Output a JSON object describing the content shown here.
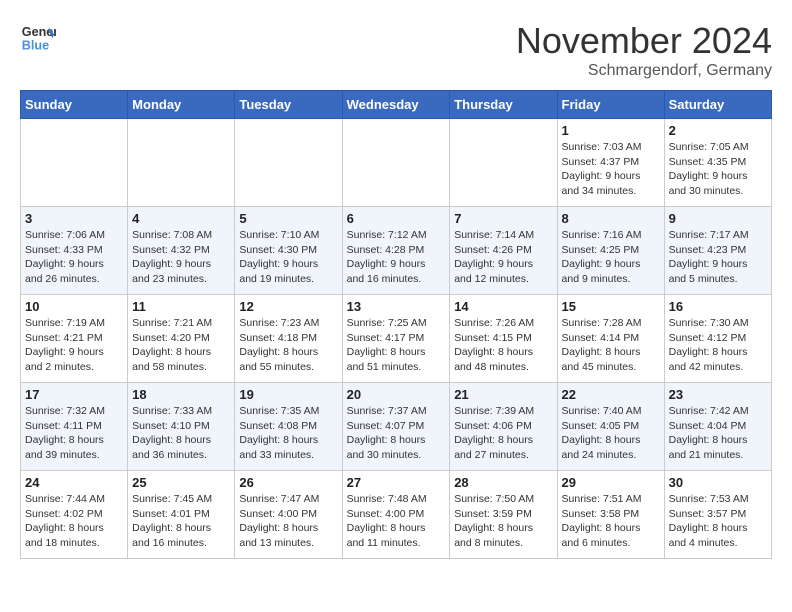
{
  "logo": {
    "line1": "General",
    "line2": "Blue"
  },
  "title": "November 2024",
  "location": "Schmargendorf, Germany",
  "headers": [
    "Sunday",
    "Monday",
    "Tuesday",
    "Wednesday",
    "Thursday",
    "Friday",
    "Saturday"
  ],
  "weeks": [
    [
      {
        "day": "",
        "info": ""
      },
      {
        "day": "",
        "info": ""
      },
      {
        "day": "",
        "info": ""
      },
      {
        "day": "",
        "info": ""
      },
      {
        "day": "",
        "info": ""
      },
      {
        "day": "1",
        "info": "Sunrise: 7:03 AM\nSunset: 4:37 PM\nDaylight: 9 hours\nand 34 minutes."
      },
      {
        "day": "2",
        "info": "Sunrise: 7:05 AM\nSunset: 4:35 PM\nDaylight: 9 hours\nand 30 minutes."
      }
    ],
    [
      {
        "day": "3",
        "info": "Sunrise: 7:06 AM\nSunset: 4:33 PM\nDaylight: 9 hours\nand 26 minutes."
      },
      {
        "day": "4",
        "info": "Sunrise: 7:08 AM\nSunset: 4:32 PM\nDaylight: 9 hours\nand 23 minutes."
      },
      {
        "day": "5",
        "info": "Sunrise: 7:10 AM\nSunset: 4:30 PM\nDaylight: 9 hours\nand 19 minutes."
      },
      {
        "day": "6",
        "info": "Sunrise: 7:12 AM\nSunset: 4:28 PM\nDaylight: 9 hours\nand 16 minutes."
      },
      {
        "day": "7",
        "info": "Sunrise: 7:14 AM\nSunset: 4:26 PM\nDaylight: 9 hours\nand 12 minutes."
      },
      {
        "day": "8",
        "info": "Sunrise: 7:16 AM\nSunset: 4:25 PM\nDaylight: 9 hours\nand 9 minutes."
      },
      {
        "day": "9",
        "info": "Sunrise: 7:17 AM\nSunset: 4:23 PM\nDaylight: 9 hours\nand 5 minutes."
      }
    ],
    [
      {
        "day": "10",
        "info": "Sunrise: 7:19 AM\nSunset: 4:21 PM\nDaylight: 9 hours\nand 2 minutes."
      },
      {
        "day": "11",
        "info": "Sunrise: 7:21 AM\nSunset: 4:20 PM\nDaylight: 8 hours\nand 58 minutes."
      },
      {
        "day": "12",
        "info": "Sunrise: 7:23 AM\nSunset: 4:18 PM\nDaylight: 8 hours\nand 55 minutes."
      },
      {
        "day": "13",
        "info": "Sunrise: 7:25 AM\nSunset: 4:17 PM\nDaylight: 8 hours\nand 51 minutes."
      },
      {
        "day": "14",
        "info": "Sunrise: 7:26 AM\nSunset: 4:15 PM\nDaylight: 8 hours\nand 48 minutes."
      },
      {
        "day": "15",
        "info": "Sunrise: 7:28 AM\nSunset: 4:14 PM\nDaylight: 8 hours\nand 45 minutes."
      },
      {
        "day": "16",
        "info": "Sunrise: 7:30 AM\nSunset: 4:12 PM\nDaylight: 8 hours\nand 42 minutes."
      }
    ],
    [
      {
        "day": "17",
        "info": "Sunrise: 7:32 AM\nSunset: 4:11 PM\nDaylight: 8 hours\nand 39 minutes."
      },
      {
        "day": "18",
        "info": "Sunrise: 7:33 AM\nSunset: 4:10 PM\nDaylight: 8 hours\nand 36 minutes."
      },
      {
        "day": "19",
        "info": "Sunrise: 7:35 AM\nSunset: 4:08 PM\nDaylight: 8 hours\nand 33 minutes."
      },
      {
        "day": "20",
        "info": "Sunrise: 7:37 AM\nSunset: 4:07 PM\nDaylight: 8 hours\nand 30 minutes."
      },
      {
        "day": "21",
        "info": "Sunrise: 7:39 AM\nSunset: 4:06 PM\nDaylight: 8 hours\nand 27 minutes."
      },
      {
        "day": "22",
        "info": "Sunrise: 7:40 AM\nSunset: 4:05 PM\nDaylight: 8 hours\nand 24 minutes."
      },
      {
        "day": "23",
        "info": "Sunrise: 7:42 AM\nSunset: 4:04 PM\nDaylight: 8 hours\nand 21 minutes."
      }
    ],
    [
      {
        "day": "24",
        "info": "Sunrise: 7:44 AM\nSunset: 4:02 PM\nDaylight: 8 hours\nand 18 minutes."
      },
      {
        "day": "25",
        "info": "Sunrise: 7:45 AM\nSunset: 4:01 PM\nDaylight: 8 hours\nand 16 minutes."
      },
      {
        "day": "26",
        "info": "Sunrise: 7:47 AM\nSunset: 4:00 PM\nDaylight: 8 hours\nand 13 minutes."
      },
      {
        "day": "27",
        "info": "Sunrise: 7:48 AM\nSunset: 4:00 PM\nDaylight: 8 hours\nand 11 minutes."
      },
      {
        "day": "28",
        "info": "Sunrise: 7:50 AM\nSunset: 3:59 PM\nDaylight: 8 hours\nand 8 minutes."
      },
      {
        "day": "29",
        "info": "Sunrise: 7:51 AM\nSunset: 3:58 PM\nDaylight: 8 hours\nand 6 minutes."
      },
      {
        "day": "30",
        "info": "Sunrise: 7:53 AM\nSunset: 3:57 PM\nDaylight: 8 hours\nand 4 minutes."
      }
    ]
  ]
}
